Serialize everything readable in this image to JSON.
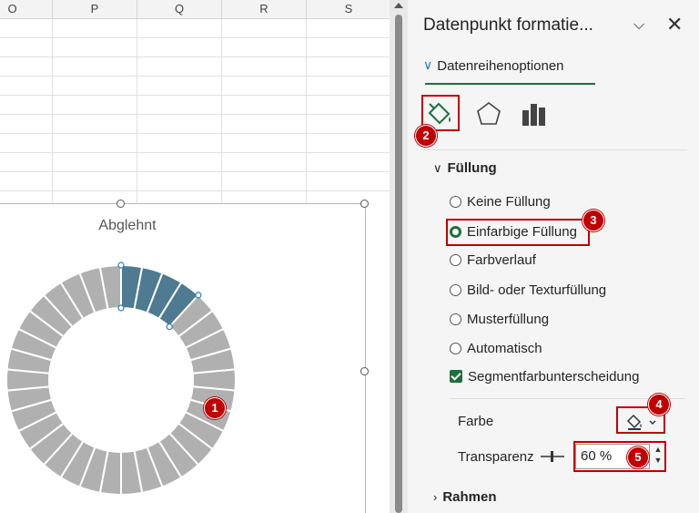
{
  "spreadsheet": {
    "columns": [
      "O",
      "P",
      "Q",
      "R",
      "S"
    ]
  },
  "chart": {
    "title": "Abglehnt",
    "segments_total": 34,
    "highlighted_segments": 4,
    "highlight_color": "#4e7a92",
    "segment_color": "#b0b0b0"
  },
  "pane": {
    "title": "Datenpunkt formatie...",
    "section_tab": "Datenreihenoptionen",
    "icons": [
      "fill-line-icon",
      "effects-icon",
      "series-options-icon"
    ],
    "fill_group": {
      "header": "Füllung",
      "options": [
        {
          "label": "Keine Füllung",
          "selected": false
        },
        {
          "label": "Einfarbige Füllung",
          "selected": true
        },
        {
          "label": "Farbverlauf",
          "selected": false
        },
        {
          "label": "Bild- oder Texturfüllung",
          "selected": false
        },
        {
          "label": "Musterfüllung",
          "selected": false
        },
        {
          "label": "Automatisch",
          "selected": false
        }
      ],
      "vary_colors_label": "Segmentfarbunterscheidung",
      "vary_colors_checked": true,
      "color_label": "Farbe",
      "transparency_label": "Transparenz",
      "transparency_value": "60 %"
    },
    "border_group": {
      "header": "Rahmen"
    }
  },
  "callouts": [
    "1",
    "2",
    "3",
    "4",
    "5"
  ],
  "accent_color": "#1f6f3f",
  "callout_color": "#c00000"
}
